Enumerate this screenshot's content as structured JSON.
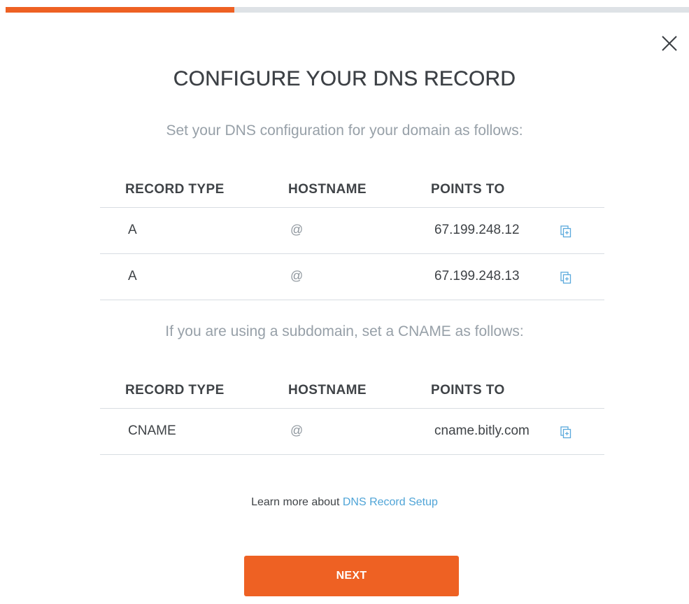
{
  "colors": {
    "accent": "#ee6123",
    "link": "#4fa4d7",
    "copy_icon": "#5aa9dc"
  },
  "progress": {
    "fraction": 0.335
  },
  "dialog": {
    "close_icon": "close-icon",
    "title": "CONFIGURE YOUR DNS RECORD",
    "subtitle": "Set your DNS configuration for your domain as follows:",
    "a_records": {
      "headers": [
        "RECORD TYPE",
        "HOSTNAME",
        "POINTS TO"
      ],
      "rows": [
        {
          "type": "A",
          "hostname": "@",
          "points_to": "67.199.248.12",
          "icon": "copy-icon"
        },
        {
          "type": "A",
          "hostname": "@",
          "points_to": "67.199.248.13",
          "icon": "copy-icon"
        }
      ]
    },
    "cname_intro": "If you are using a subdomain, set a CNAME as follows:",
    "cname_records": {
      "headers": [
        "RECORD TYPE",
        "HOSTNAME",
        "POINTS TO"
      ],
      "rows": [
        {
          "type": "CNAME",
          "hostname": "@",
          "points_to": "cname.bitly.com",
          "icon": "copy-icon"
        }
      ]
    },
    "learn_more_prefix": "Learn more about ",
    "learn_more_link": "DNS Record Setup",
    "next_button": "NEXT"
  }
}
